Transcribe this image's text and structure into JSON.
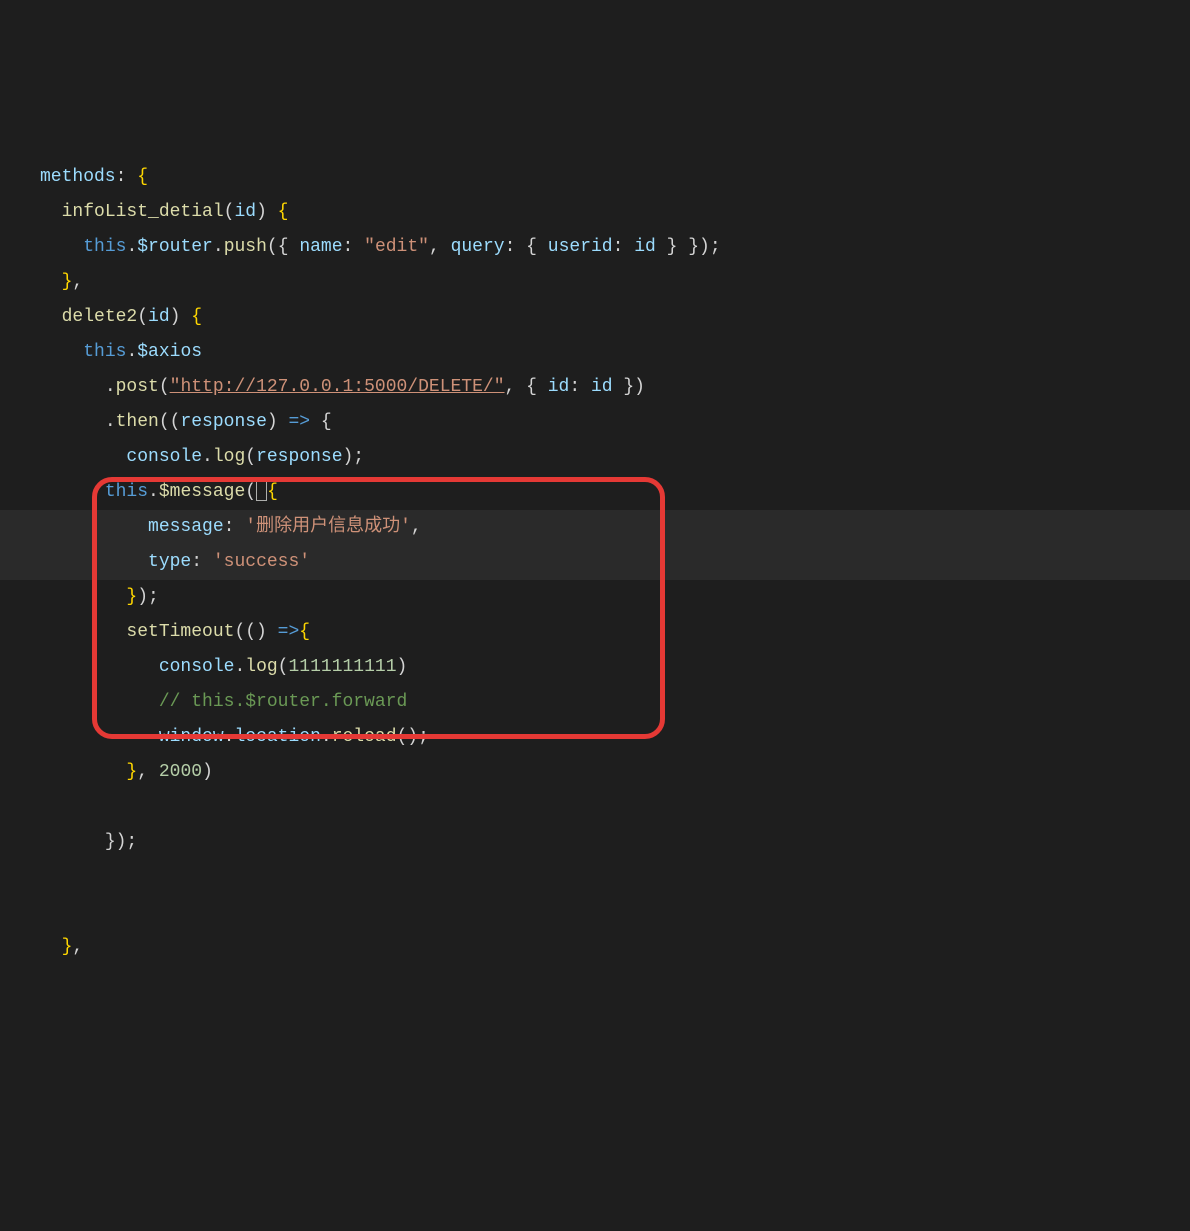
{
  "colors": {
    "background": "#1e1e1e",
    "text": "#d4d4d4",
    "highlight_bg": "#2a2a2a",
    "prop_name": "#9cdcfe",
    "method_name": "#dcdcaa",
    "keyword": "#569cd6",
    "string": "#ce9178",
    "number": "#b5cea8",
    "comment": "#6a9955",
    "brace_gold": "#ffd700",
    "red_box": "#e53935"
  },
  "code": {
    "methods_key": "methods",
    "infoList_method": "infoList_detial",
    "infoList_param": "id",
    "this_kw": "this",
    "router_prop": "$router",
    "push_method": "push",
    "name_key": "name",
    "edit_str": "\"edit\"",
    "query_key": "query",
    "userid_key": "userid",
    "id_val": "id",
    "delete2_method": "delete2",
    "delete2_param": "id",
    "axios_prop": "$axios",
    "post_method": "post",
    "url_str": "\"http://127.0.0.1:5000/DELETE/\"",
    "id_key": "id",
    "then_method": "then",
    "response_param": "response",
    "console_obj": "console",
    "log_method": "log",
    "response_arg": "response",
    "message_prop": "$message",
    "message_key": "message",
    "delete_success_str": "'删除用户信息成功'",
    "type_key": "type",
    "success_str": "'success'",
    "setTimeout_fn": "setTimeout",
    "log_num": "1111111111",
    "comment_text": "// this.$router.forward",
    "window_obj": "window",
    "location_prop": "location",
    "reload_method": "reload",
    "timeout_val": "2000"
  }
}
